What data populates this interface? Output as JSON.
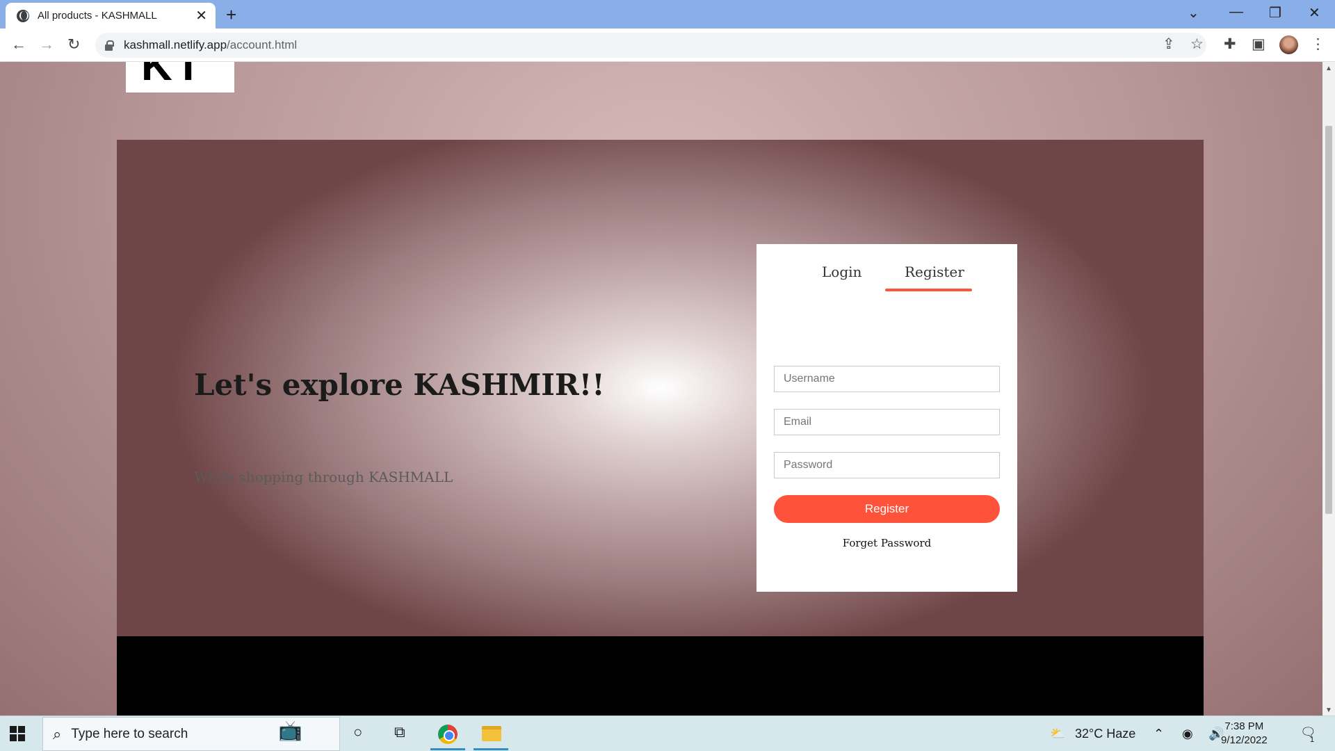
{
  "browser": {
    "tab_title": "All products - KASHMALL",
    "url_host": "kashmall.netlify.app",
    "url_path": "/account.html"
  },
  "page": {
    "logo_text": "KT",
    "headline": "Let's explore KASHMIR!!",
    "subline": "While shopping through KASHMALL",
    "form": {
      "tabs": [
        "Login",
        "Register"
      ],
      "active_tab": "Register",
      "username_placeholder": "Username",
      "email_placeholder": "Email",
      "password_placeholder": "Password",
      "submit_label": "Register",
      "forgot_label": "Forget Password"
    },
    "colors": {
      "accent": "#ff523b",
      "footer": "#000000"
    }
  },
  "taskbar": {
    "search_placeholder": "Type here to search",
    "weather": "32°C  Haze",
    "time": "7:38 PM",
    "date": "9/12/2022",
    "notification_count": "1"
  }
}
